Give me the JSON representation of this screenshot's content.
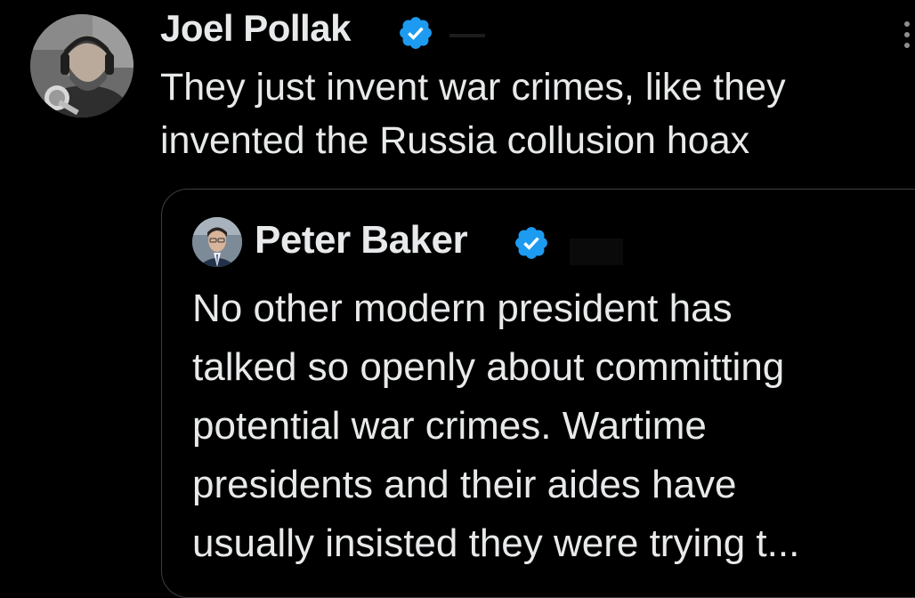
{
  "tweet": {
    "author": {
      "name": "Joel Pollak",
      "verified": true,
      "avatar_icon": "man-with-headphones-and-microphone-avatar"
    },
    "text_lines": [
      "They just invent war crimes, like they",
      "invented the Russia collusion hoax"
    ],
    "more_icon": "vertical-ellipsis-icon"
  },
  "quoted_tweet": {
    "author": {
      "name": "Peter Baker",
      "verified": true,
      "avatar_icon": "man-in-suit-avatar"
    },
    "text_lines": [
      "No other modern president has",
      "talked so openly about committing",
      "potential war crimes. Wartime",
      "presidents and their aides have",
      "usually insisted they were trying t..."
    ]
  },
  "colors": {
    "background": "#000000",
    "text": "#e7e9ea",
    "verified_badge": "#1d9bf0",
    "quote_border": "#3a3f44",
    "muted_icon": "#8b8f93"
  }
}
